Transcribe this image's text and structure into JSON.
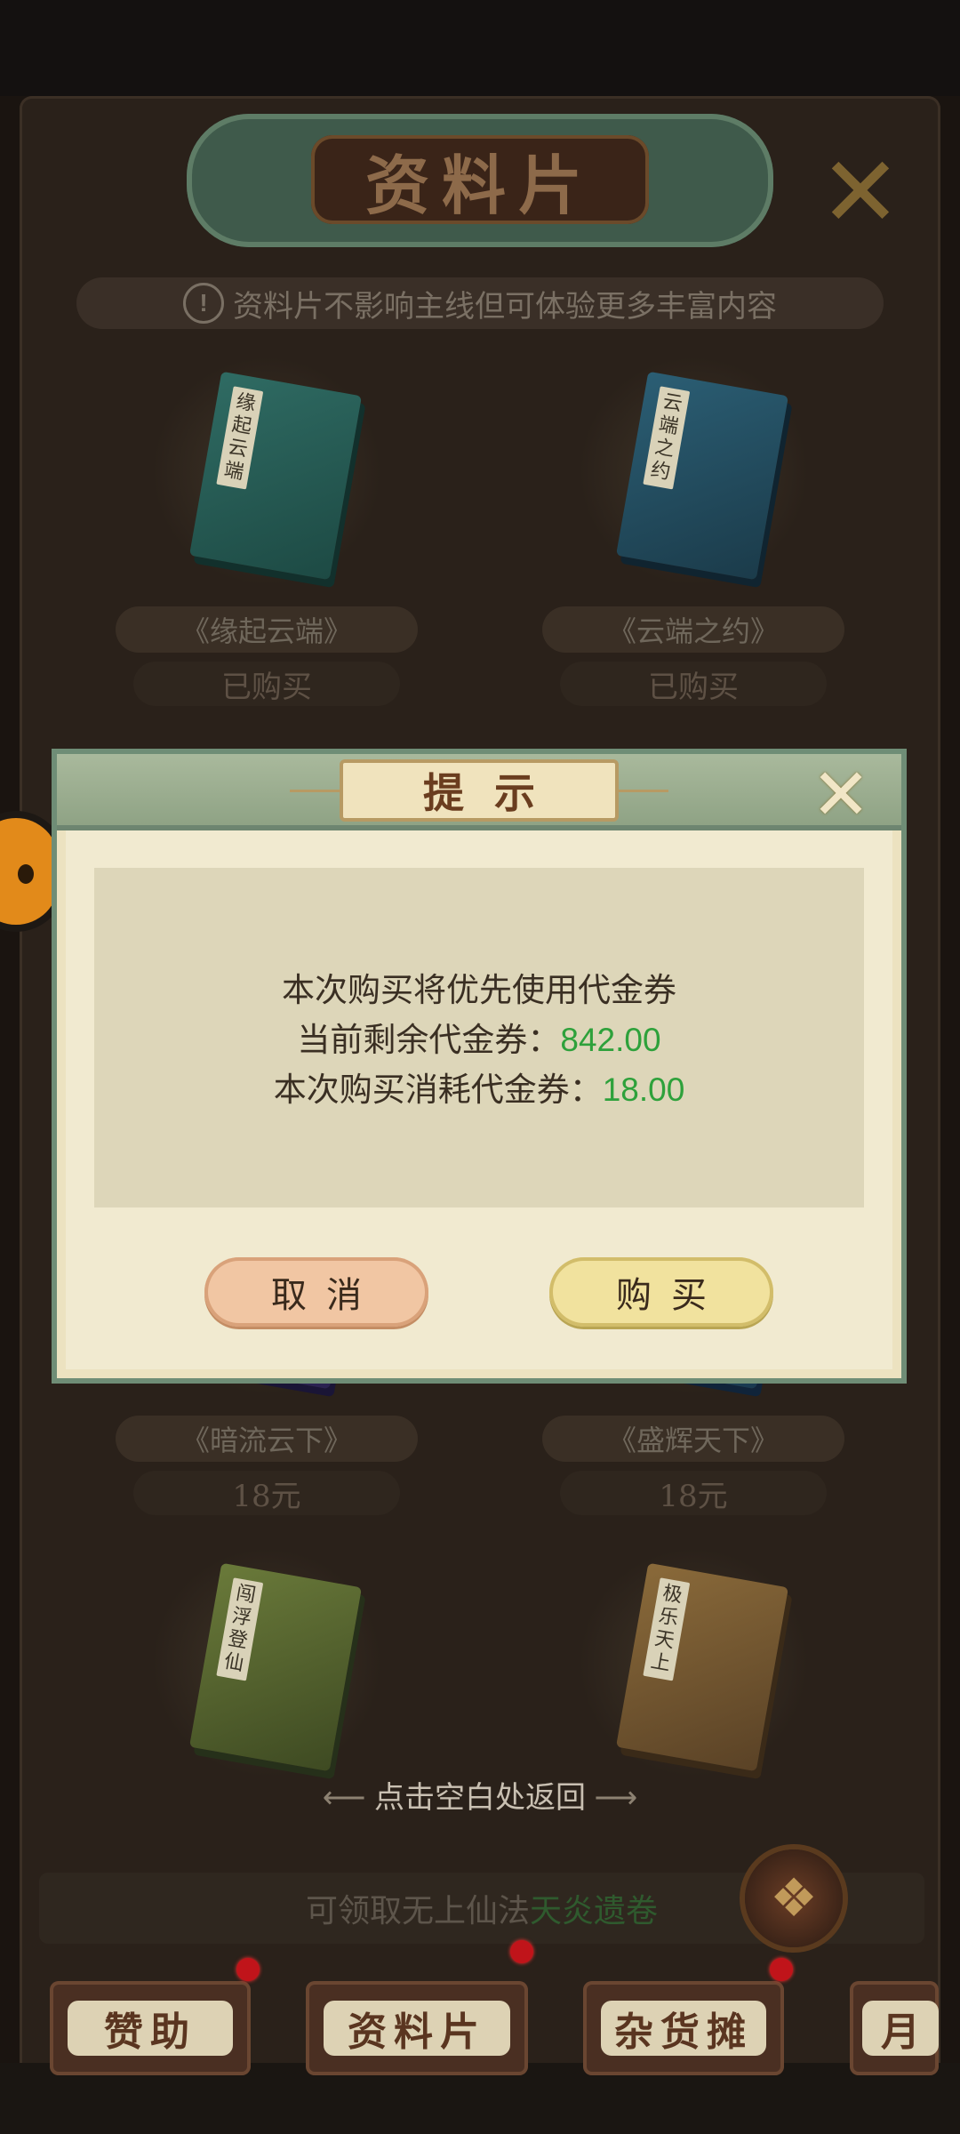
{
  "page": {
    "title": "资料片",
    "notice": "资料片不影响主线但可体验更多丰富内容",
    "close_icon": "close-x-icon"
  },
  "books": [
    {
      "name": "《缘起云端》",
      "cover_text": "缘起云端",
      "status": "已购买"
    },
    {
      "name": "《云端之约》",
      "cover_text": "云端之约",
      "status": "已购买"
    },
    {
      "name": "《暗流云下》",
      "status": "18元"
    },
    {
      "name": "《盛辉天下》",
      "status": "18元"
    },
    {
      "name": "",
      "cover_text": "闯浮登仙"
    },
    {
      "name": "",
      "cover_text": "极乐天上"
    }
  ],
  "return_hint": "点击空白处返回",
  "claim_bar": {
    "prefix": "可领取无上仙法",
    "highlight": "天炎遗卷"
  },
  "tabs": [
    "赞助",
    "资料片",
    "杂货摊",
    "月"
  ],
  "dialog": {
    "title": "提示",
    "line1": "本次购买将优先使用代金券",
    "line2_label": "当前剩余代金券：",
    "line2_value": "842.00",
    "line3_label": "本次购买消耗代金券：",
    "line3_value": "18.00",
    "cancel_label": "取消",
    "buy_label": "购买"
  },
  "colors": {
    "value_green": "#2ea13b",
    "red_dot": "#c0141a",
    "dialog_bg": "#f1ead0",
    "header_green": "#8da183"
  }
}
